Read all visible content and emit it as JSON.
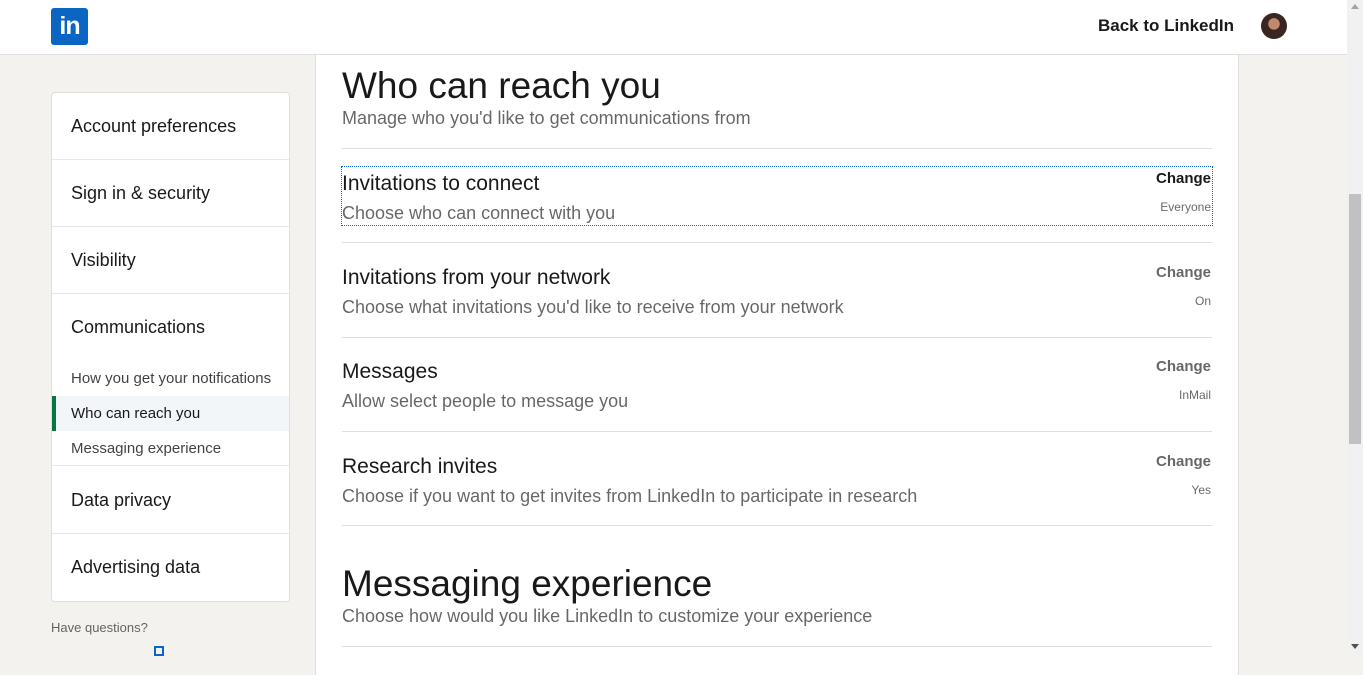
{
  "header": {
    "logo_text": "in",
    "back_link": "Back to LinkedIn",
    "avatar_icon": "user-avatar"
  },
  "sidebar": {
    "items": [
      {
        "label": "Account preferences"
      },
      {
        "label": "Sign in & security"
      },
      {
        "label": "Visibility"
      },
      {
        "label": "Communications"
      },
      {
        "label": "Data privacy"
      },
      {
        "label": "Advertising data"
      }
    ],
    "sub_items": [
      {
        "label": "How you get your notifications"
      },
      {
        "label": "Who can reach you",
        "active": true
      },
      {
        "label": "Messaging experience"
      }
    ],
    "help_text": "Have questions?"
  },
  "main": {
    "section1": {
      "title": "Who can reach you",
      "subtitle": "Manage who you'd like to get communications from",
      "settings": [
        {
          "title": "Invitations to connect",
          "description": "Choose who can connect with you",
          "action": "Change",
          "value": "Everyone"
        },
        {
          "title": "Invitations from your network",
          "description": "Choose what invitations you'd like to receive from your network",
          "action": "Change",
          "value": "On"
        },
        {
          "title": "Messages",
          "description": "Allow select people to message you",
          "action": "Change",
          "value": "InMail"
        },
        {
          "title": "Research invites",
          "description": "Choose if you want to get invites from LinkedIn to participate in research",
          "action": "Change",
          "value": "Yes"
        }
      ]
    },
    "section2": {
      "title": "Messaging experience",
      "subtitle": "Choose how would you like LinkedIn to customize your experience"
    }
  },
  "colors": {
    "brand": "#0a66c2",
    "active_indicator": "#057642",
    "background": "#f3f2ef"
  }
}
